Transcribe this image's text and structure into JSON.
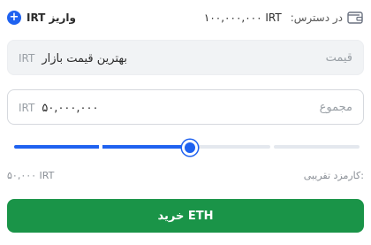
{
  "balance": {
    "label": "در دسترس:",
    "value": "۱۰۰,۰۰۰,۰۰۰ IRT",
    "icon": "wallet-icon"
  },
  "deposit": {
    "label": "واریز IRT",
    "icon": "plus-circle-icon",
    "color": "#1f62f0"
  },
  "price_field": {
    "label": "قیمت",
    "value": "بهترین قیمت بازار",
    "unit": "IRT"
  },
  "total_field": {
    "label": "مجموع",
    "value": "۵۰,۰۰۰,۰۰۰",
    "unit": "IRT"
  },
  "slider": {
    "percent": 51,
    "accent": "#1f62f0"
  },
  "fee": {
    "label": "کارمزد تقریبی:",
    "value": "۵۰,۰۰۰ IRT"
  },
  "buy_button": {
    "label": "خرید ETH",
    "color": "#1a9448"
  }
}
